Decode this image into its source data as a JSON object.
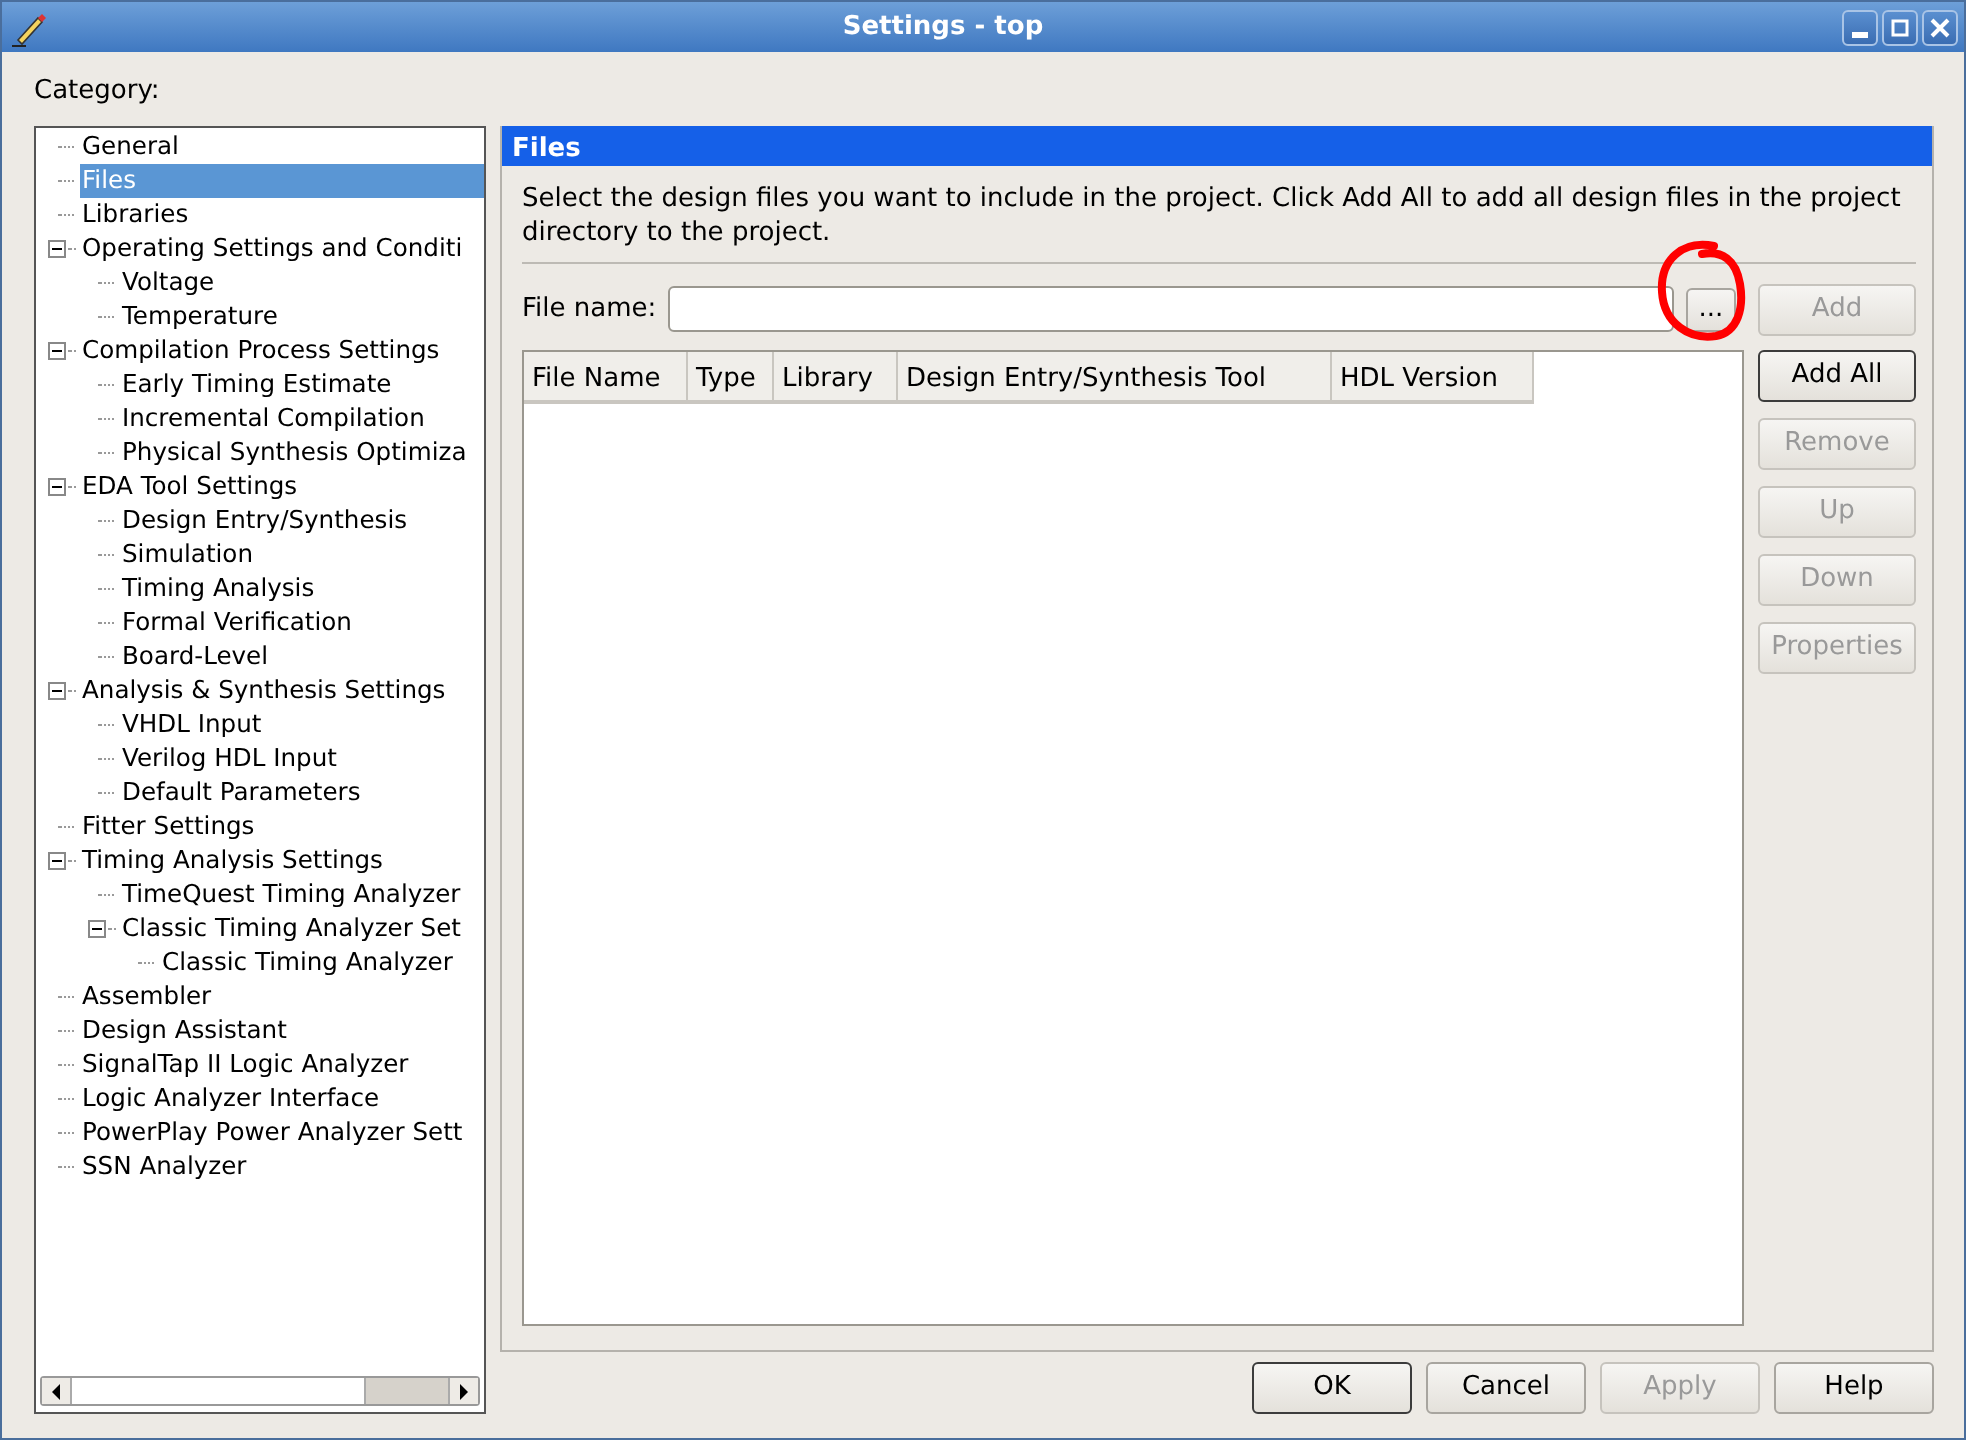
{
  "window": {
    "title": "Settings - top"
  },
  "category_label": "Category:",
  "category_tree": [
    {
      "label": "General",
      "selected": false
    },
    {
      "label": "Files",
      "selected": true
    },
    {
      "label": "Libraries",
      "selected": false
    },
    {
      "label": "Operating Settings and Conditi",
      "selected": false,
      "expanded": true,
      "children": [
        {
          "label": "Voltage",
          "selected": false
        },
        {
          "label": "Temperature",
          "selected": false
        }
      ]
    },
    {
      "label": "Compilation Process Settings",
      "selected": false,
      "expanded": true,
      "children": [
        {
          "label": "Early Timing Estimate",
          "selected": false
        },
        {
          "label": "Incremental Compilation",
          "selected": false
        },
        {
          "label": "Physical Synthesis Optimiza",
          "selected": false
        }
      ]
    },
    {
      "label": "EDA Tool Settings",
      "selected": false,
      "expanded": true,
      "children": [
        {
          "label": "Design Entry/Synthesis",
          "selected": false
        },
        {
          "label": "Simulation",
          "selected": false
        },
        {
          "label": "Timing Analysis",
          "selected": false
        },
        {
          "label": "Formal Verification",
          "selected": false
        },
        {
          "label": "Board-Level",
          "selected": false
        }
      ]
    },
    {
      "label": "Analysis & Synthesis Settings",
      "selected": false,
      "expanded": true,
      "children": [
        {
          "label": "VHDL Input",
          "selected": false
        },
        {
          "label": "Verilog HDL Input",
          "selected": false
        },
        {
          "label": "Default Parameters",
          "selected": false
        }
      ]
    },
    {
      "label": "Fitter Settings",
      "selected": false
    },
    {
      "label": "Timing Analysis Settings",
      "selected": false,
      "expanded": true,
      "children": [
        {
          "label": "TimeQuest Timing Analyzer",
          "selected": false
        },
        {
          "label": "Classic Timing Analyzer Set",
          "selected": false,
          "expanded": true,
          "children": [
            {
              "label": "Classic Timing Analyzer",
              "selected": false
            }
          ]
        }
      ]
    },
    {
      "label": "Assembler",
      "selected": false
    },
    {
      "label": "Design Assistant",
      "selected": false
    },
    {
      "label": "SignalTap II Logic Analyzer",
      "selected": false
    },
    {
      "label": "Logic Analyzer Interface",
      "selected": false
    },
    {
      "label": "PowerPlay Power Analyzer Sett",
      "selected": false
    },
    {
      "label": "SSN Analyzer",
      "selected": false
    }
  ],
  "panel": {
    "title": "Files",
    "description": "Select the design files you want to include in the project. Click Add All to add all design files in the project directory to the project.",
    "file_name_field": {
      "label": "File name:"
    },
    "browse_button": {
      "label": "...",
      "annotation": {
        "kind": "circle",
        "color": "#ff0000"
      }
    },
    "side_buttons": [
      {
        "label": "Add",
        "disabled": true,
        "default": false
      },
      {
        "label": "Add All",
        "disabled": false,
        "default": true
      },
      {
        "label": "Remove",
        "disabled": true,
        "default": false
      },
      {
        "label": "Up",
        "disabled": true,
        "default": false
      },
      {
        "label": "Down",
        "disabled": true,
        "default": false
      },
      {
        "label": "Properties",
        "disabled": true,
        "default": false
      }
    ],
    "table": {
      "columns": [
        "File Name",
        "Type",
        "Library",
        "Design Entry/Synthesis Tool",
        "HDL Version"
      ]
    }
  },
  "buttons": [
    {
      "label": "OK",
      "disabled": false,
      "default": true
    },
    {
      "label": "Cancel",
      "disabled": false,
      "default": false
    },
    {
      "label": "Apply",
      "disabled": true,
      "default": false
    },
    {
      "label": "Help",
      "disabled": false,
      "default": false
    }
  ]
}
